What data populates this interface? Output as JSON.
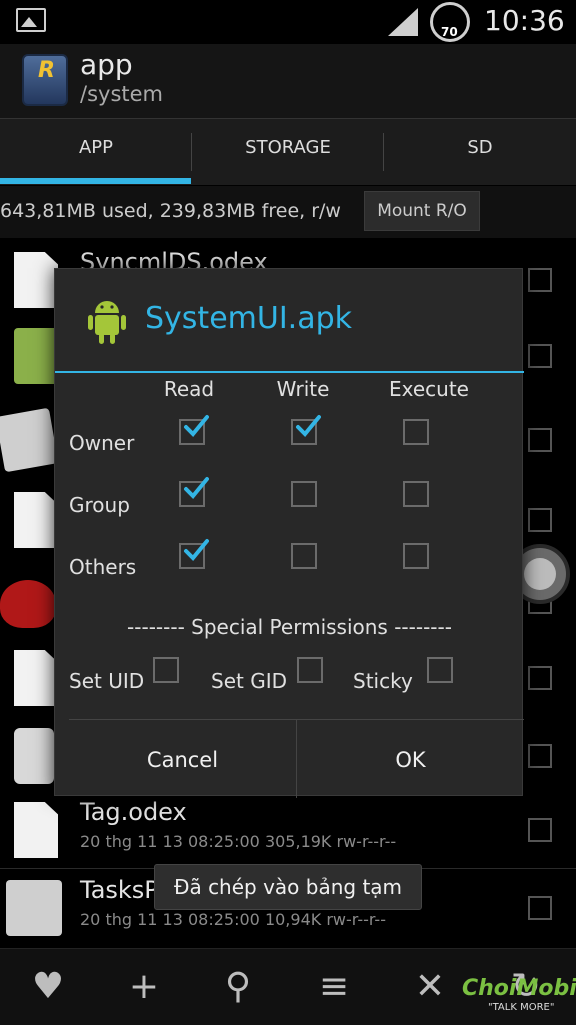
{
  "status_bar": {
    "time": "10:36",
    "speed_value": "70"
  },
  "action_bar": {
    "title": "app",
    "subtitle": "/system"
  },
  "tabs": [
    {
      "label": "APP",
      "selected": true
    },
    {
      "label": "STORAGE",
      "selected": false
    },
    {
      "label": "SD",
      "selected": false
    }
  ],
  "storage": {
    "text": "643,81MB used, 239,83MB free, r/w",
    "mount_button": "Mount R/O"
  },
  "files": [
    {
      "name": "SyncmlDS.odex",
      "meta": ""
    },
    {
      "name": "",
      "meta": ""
    },
    {
      "name": "",
      "meta": ""
    },
    {
      "name": "",
      "meta": ""
    },
    {
      "name": "",
      "meta": ""
    },
    {
      "name": "",
      "meta": ""
    },
    {
      "name": "",
      "meta": ""
    },
    {
      "name": "Tag.odex",
      "meta": "20 thg 11 13 08:25:00  305,19K  rw-r--r--"
    },
    {
      "name": "TasksP",
      "meta": "20 thg 11 13 08:25:00  10,94K  rw-r--r--"
    }
  ],
  "dialog": {
    "title": "SystemUI.apk",
    "columns": [
      "Read",
      "Write",
      "Execute"
    ],
    "rows": [
      {
        "label": "Owner",
        "checks": [
          true,
          true,
          false
        ]
      },
      {
        "label": "Group",
        "checks": [
          true,
          false,
          false
        ]
      },
      {
        "label": "Others",
        "checks": [
          true,
          false,
          false
        ]
      }
    ],
    "special_title": "-------- Special Permissions --------",
    "special": [
      {
        "label": "Set UID",
        "checked": false
      },
      {
        "label": "Set GID",
        "checked": false
      },
      {
        "label": "Sticky",
        "checked": false
      }
    ],
    "cancel_label": "Cancel",
    "ok_label": "OK"
  },
  "toast": "Đã chép vào bảng tạm",
  "watermark": {
    "brand": "ChoiMobile",
    "tagline": "\"TALK MORE\""
  },
  "colors": {
    "accent": "#33b5e5",
    "check": "#33b5e5"
  }
}
